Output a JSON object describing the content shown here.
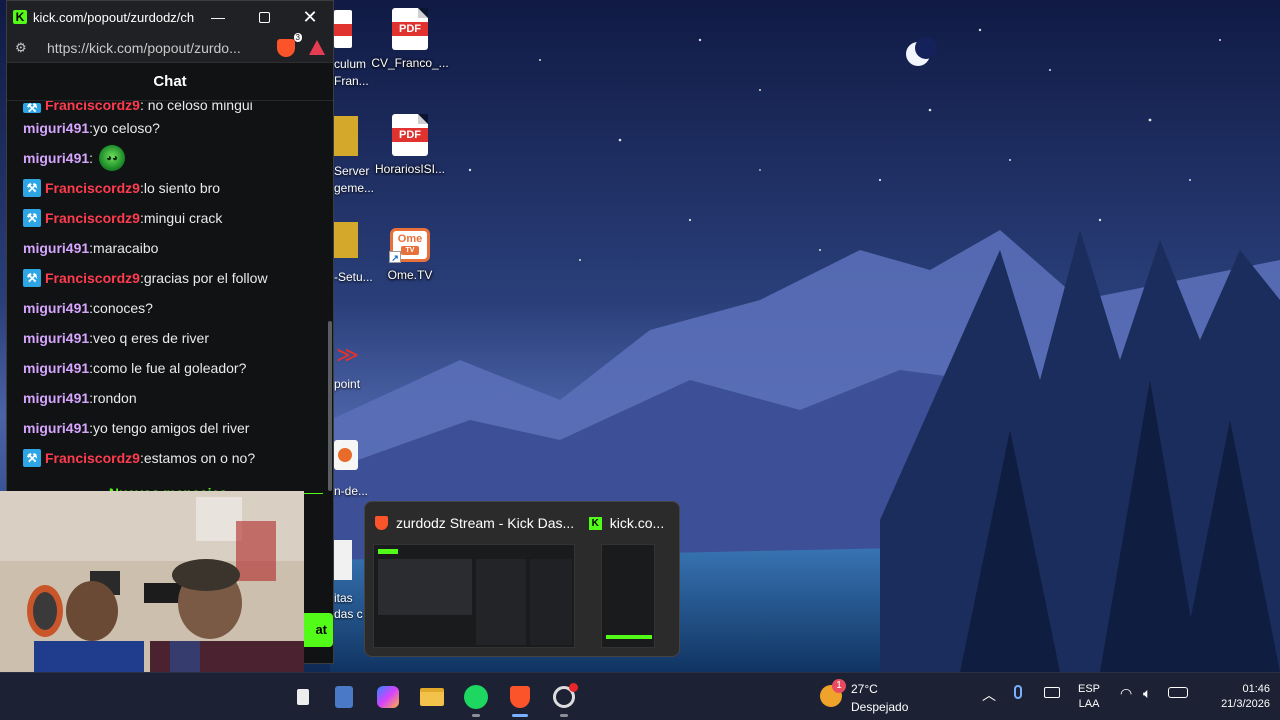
{
  "browser": {
    "title": "kick.com/popout/zurdodz/ch...",
    "url": "https://kick.com/popout/zurdo...",
    "shield_count": "3",
    "chat_title": "Chat",
    "send_label": "at",
    "new_messages_label": "Nuevos mensajes"
  },
  "chat": {
    "partial_top": {
      "user": "Franciscordz9",
      "text": ": no celoso mingui"
    },
    "messages": [
      {
        "user": "miguri491",
        "sep": ":",
        "text": " yo celoso?",
        "mod": false
      },
      {
        "user": "miguri491",
        "sep": ":",
        "text": "",
        "mod": false,
        "emote": "emote-icon"
      },
      {
        "user": "Franciscordz9",
        "sep": ":",
        "text": " lo siento bro",
        "mod": true
      },
      {
        "user": "Franciscordz9",
        "sep": ":",
        "text": " mingui crack",
        "mod": true
      },
      {
        "user": "miguri491",
        "sep": ":",
        "text": " maracaibo",
        "mod": false
      },
      {
        "user": "Franciscordz9",
        "sep": ":",
        "text": " gracias por el follow",
        "mod": true
      },
      {
        "user": "miguri491",
        "sep": ":",
        "text": " conoces?",
        "mod": false
      },
      {
        "user": "miguri491",
        "sep": ":",
        "text": " veo q eres de river",
        "mod": false
      },
      {
        "user": "miguri491",
        "sep": ":",
        "text": " como le fue al goleador?",
        "mod": false
      },
      {
        "user": "miguri491",
        "sep": ":",
        "text": " rondon",
        "mod": false
      },
      {
        "user": "miguri491",
        "sep": ":",
        "text": " yo tengo amigos del river",
        "mod": false
      },
      {
        "user": "Franciscordz9",
        "sep": ":",
        "text": " estamos on o no?",
        "mod": true
      }
    ],
    "colors": {
      "miguri491": "#d6a6ff",
      "Franciscordz9": "#ff3b4e"
    }
  },
  "desktop": {
    "icons": [
      {
        "label": "CV_Franco_...",
        "type": "pdf"
      },
      {
        "label": "HorariosISI...",
        "type": "pdf"
      },
      {
        "label": "Ome.TV",
        "type": "ometv"
      }
    ],
    "partial_labels": [
      "culum",
      "Fran...",
      "Server",
      "geme...",
      "-Setu...",
      "point",
      "n-de...",
      "itas",
      "das c"
    ]
  },
  "preview": {
    "items": [
      {
        "title": "zurdodz Stream - Kick Das...",
        "icon": "brave-icon"
      },
      {
        "title": "kick.co...",
        "icon": "kick-icon"
      }
    ]
  },
  "taskbar": {
    "weather_temp": "27°C",
    "weather_condition": "Despejado",
    "weather_badge": "1",
    "lang_top": "ESP",
    "lang_bottom": "LAA",
    "time": "01:46",
    "date": "21/3/2026"
  }
}
